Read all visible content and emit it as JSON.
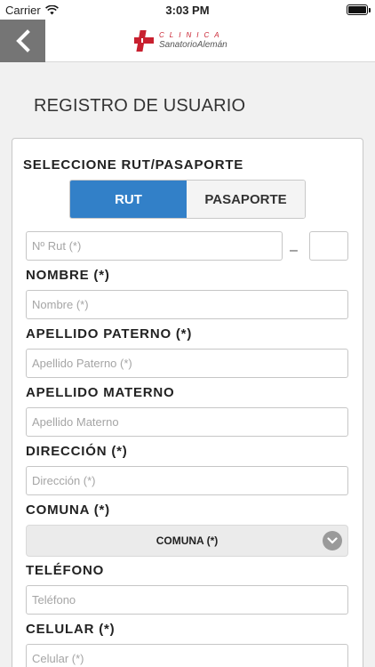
{
  "status_bar": {
    "carrier": "Carrier",
    "time": "3:03 PM"
  },
  "nav": {
    "logo_top": "CLINICA",
    "logo_bottom": "SanatorioAlemán"
  },
  "page": {
    "title": "REGISTRO DE USUARIO"
  },
  "form": {
    "doc_type_label": "SELECCIONE RUT/PASAPORTE",
    "doc_type_options": [
      "RUT",
      "PASAPORTE"
    ],
    "doc_type_selected": "RUT",
    "rut_placeholder": "Nº Rut (*)",
    "rut_separator": "–",
    "dv_placeholder": "",
    "nombre_label": "NOMBRE (*)",
    "nombre_placeholder": "Nombre (*)",
    "paterno_label": "APELLIDO PATERNO (*)",
    "paterno_placeholder": "Apellido Paterno (*)",
    "materno_label": "APELLIDO MATERNO",
    "materno_placeholder": "Apellido Materno",
    "direccion_label": "DIRECCIÓN (*)",
    "direccion_placeholder": "Dirección (*)",
    "comuna_label": "COMUNA (*)",
    "comuna_value": "COMUNA (*)",
    "telefono_label": "TELÉFONO",
    "telefono_placeholder": "Teléfono",
    "celular_label": "CELULAR (*)",
    "celular_placeholder": "Celular (*)"
  },
  "colors": {
    "accent": "#3280c8",
    "brand_red": "#c8202f",
    "nav_back": "#757575"
  }
}
